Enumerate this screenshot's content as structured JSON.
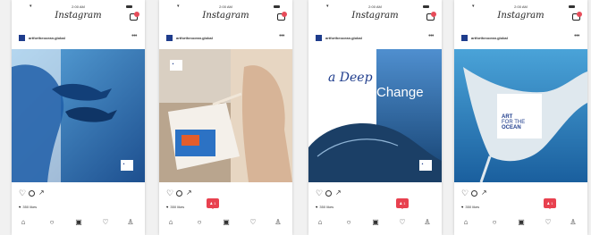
{
  "status": {
    "time": "2:00 AM"
  },
  "app_title": "Instagram",
  "account": "artfortheocean.global",
  "likes_text": "350 likes",
  "badge_count": "1",
  "posts": [
    {
      "id": 1,
      "theme": "portrait-dolphins"
    },
    {
      "id": 2,
      "theme": "painter"
    },
    {
      "id": 3,
      "theme": "whale",
      "headline_a": "a Deep",
      "headline_b": "Change"
    },
    {
      "id": 4,
      "theme": "manta-ray",
      "logo_line1": "ART",
      "logo_line2": "FOR THE",
      "logo_line3": "OCEAN"
    }
  ],
  "colors": {
    "brand_blue": "#1e3c8c",
    "badge_red": "#e8414f",
    "ocean_light": "#5aa6dc",
    "ocean_dark": "#1d4f8f"
  },
  "icons": [
    "heart-icon",
    "comment-icon",
    "share-icon",
    "home-icon",
    "search-icon",
    "camera-icon",
    "activity-icon",
    "profile-icon",
    "more-icon"
  ]
}
